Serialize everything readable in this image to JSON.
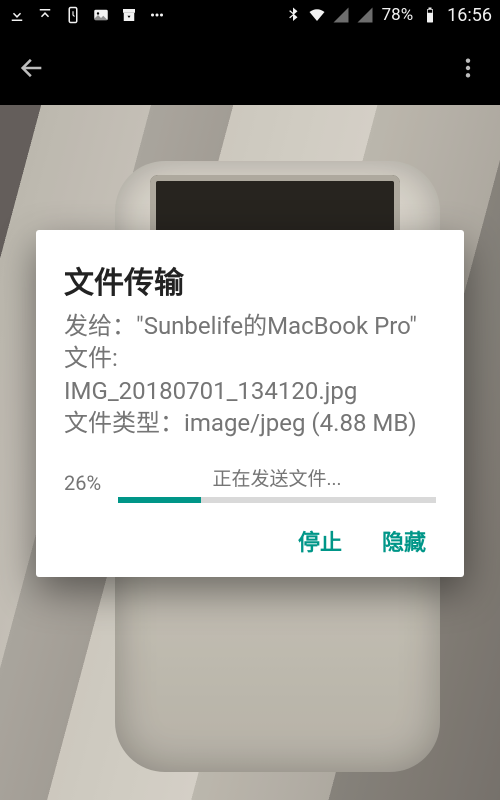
{
  "status_bar": {
    "battery_pct": "78%",
    "clock": "16:56"
  },
  "dialog": {
    "title": "文件传输",
    "send_to_label": "发给：",
    "send_to_value": "\"Sunbelife的MacBook Pro\"",
    "file_label": "文件:",
    "file_name": "IMG_20180701_134120.jpg",
    "type_label": "文件类型：",
    "type_value": "image/jpeg",
    "size_value": "(4.88 MB)",
    "progress_label": "正在发送文件...",
    "progress_pct_text": "26%",
    "progress_pct_value": 26,
    "actions": {
      "stop": "停止",
      "hide": "隐藏"
    }
  },
  "colors": {
    "accent": "#009688"
  }
}
